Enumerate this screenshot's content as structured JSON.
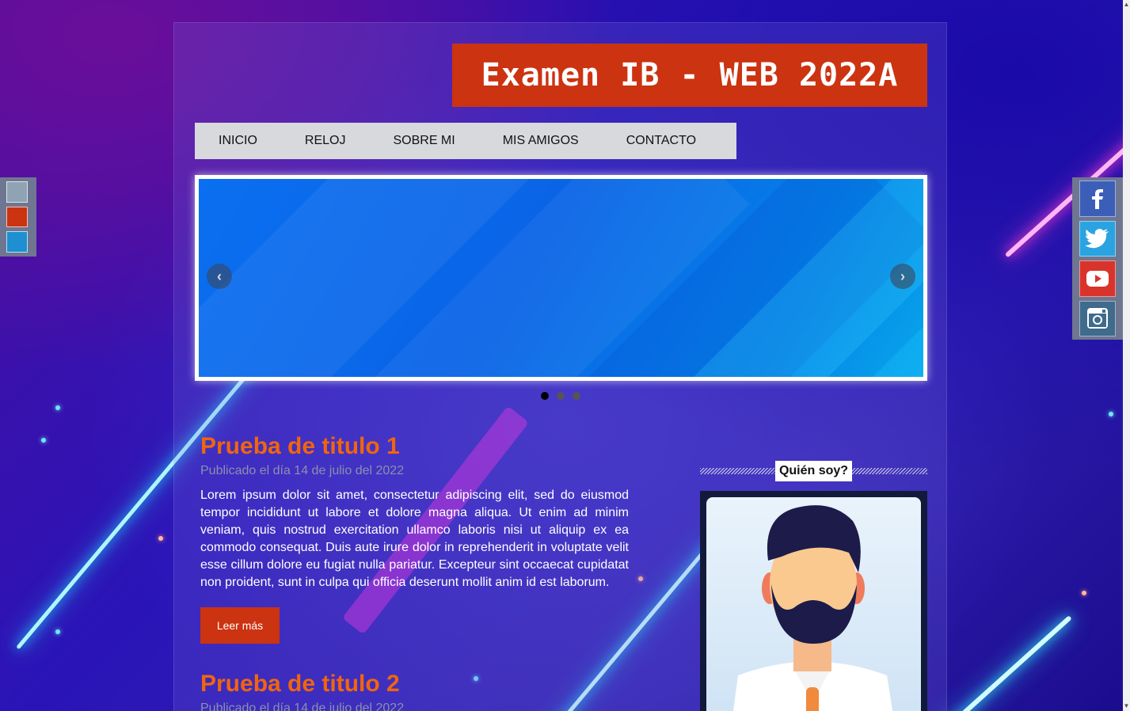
{
  "header": {
    "title": "Examen IB - WEB 2022A"
  },
  "nav": {
    "items": [
      {
        "label": "INICIO"
      },
      {
        "label": "RELOJ"
      },
      {
        "label": "SOBRE MI"
      },
      {
        "label": "MIS AMIGOS"
      },
      {
        "label": "CONTACTO"
      }
    ]
  },
  "slider": {
    "prev_label": "‹",
    "next_label": "›",
    "slide_count": 3,
    "active_slide": 1
  },
  "posts": [
    {
      "title": "Prueba de titulo 1",
      "meta": "Publicado el día 14 de julio del 2022",
      "body": "Lorem ipsum dolor sit amet, consectetur adipiscing elit, sed do eiusmod tempor incididunt ut labore et dolore magna aliqua. Ut enim ad minim veniam, quis nostrud exercitation ullamco laboris nisi ut aliquip ex ea commodo consequat. Duis aute irure dolor in reprehenderit in voluptate velit esse cillum dolore eu fugiat nulla pariatur. Excepteur sint occaecat cupidatat non proident, sunt in culpa qui officia deserunt mollit anim id est laborum.",
      "button": "Leer más"
    },
    {
      "title": "Prueba de titulo 2",
      "meta": "Publicado el día 14 de julio del 2022"
    }
  ],
  "aside": {
    "heading": "Quién soy?"
  },
  "theme_swatches": [
    "#8fa3b5",
    "#cc3311",
    "#1e8fd0"
  ],
  "social": [
    {
      "icon": "facebook-icon",
      "color": "#3b5fb8"
    },
    {
      "icon": "twitter-icon",
      "color": "#2aa3e0"
    },
    {
      "icon": "youtube-icon",
      "color": "#d9342b"
    },
    {
      "icon": "instagram-icon",
      "color": "#3f6b8c"
    }
  ],
  "colors": {
    "accent": "#cc3311",
    "post_title": "#f0650d",
    "nav_bg": "#d7d9dc"
  }
}
